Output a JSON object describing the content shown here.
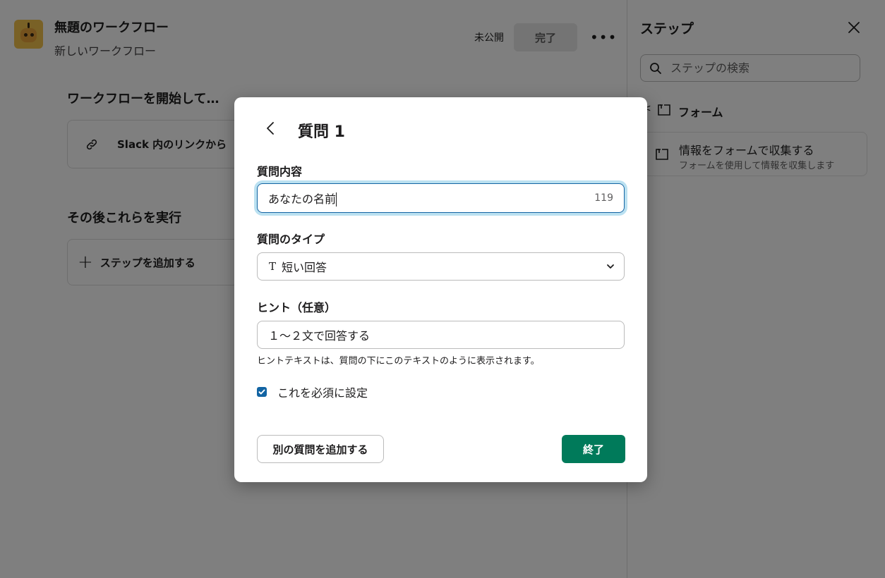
{
  "workflow": {
    "title": "無題のワークフロー",
    "subtitle": "新しいワークフロー",
    "status": "未公開",
    "done_label": "完了",
    "more_label": "•••"
  },
  "main": {
    "start_title": "ワークフローを開始して…",
    "trigger_text": "Slack 内のリンクから",
    "then_title": "その後これらを実行",
    "add_step_label": "ステップを追加する"
  },
  "steps_panel": {
    "title": "ステップ",
    "search_placeholder": "ステップの検索",
    "back_label": "<",
    "category": "フォーム",
    "item_title": "情報をフォームで収集する",
    "item_desc": "フォームを使用して情報を収集します"
  },
  "modal": {
    "title": "質問 1",
    "question_label": "質問内容",
    "question_value": "あなたの名前",
    "question_remaining": "119",
    "type_label": "質問のタイプ",
    "type_icon": "T",
    "type_value": "短い回答",
    "hint_label": "ヒント（任意）",
    "hint_value": "１〜２文で回答する",
    "hint_help": "ヒントテキストは、質問の下にこのテキストのように表示されます。",
    "required_label": "これを必須に設定",
    "required_checked": true,
    "add_question_label": "別の質問を追加する",
    "finish_label": "終了"
  },
  "colors": {
    "accent_green": "#007a5a",
    "focus_blue": "#1264a3",
    "checkbox_blue": "#1264a3"
  }
}
